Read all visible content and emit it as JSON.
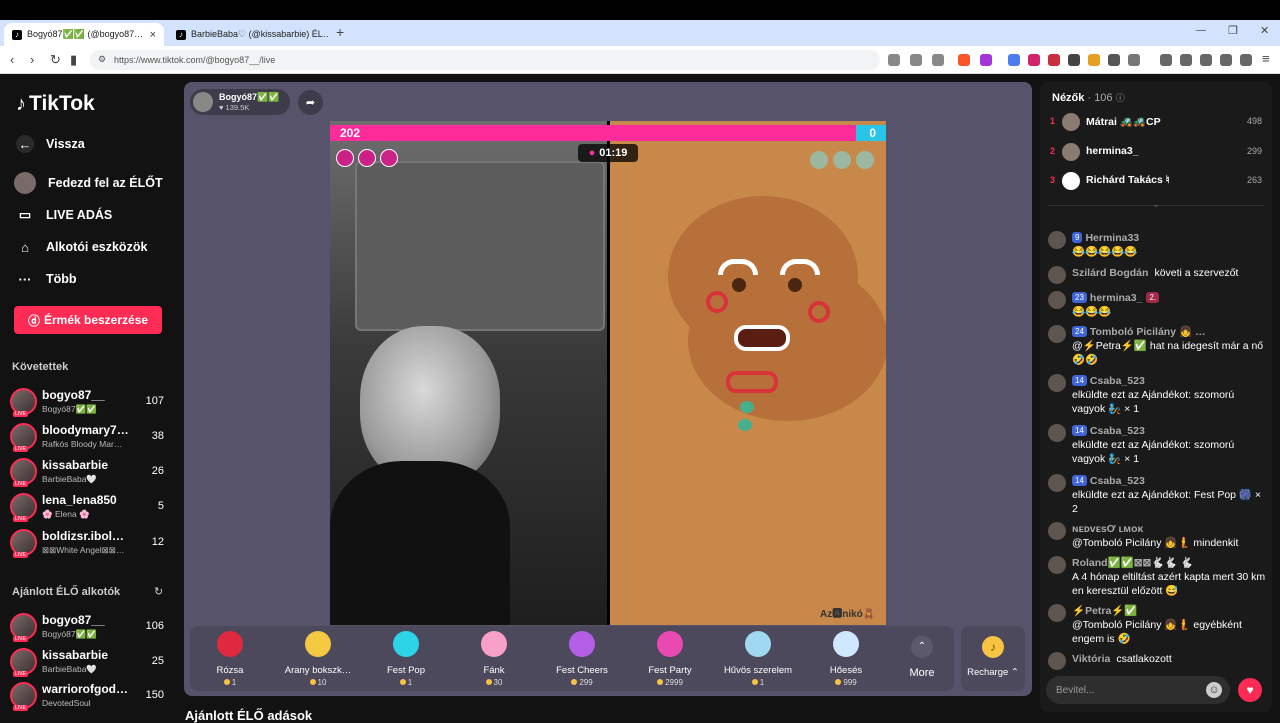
{
  "browser": {
    "tabs": [
      {
        "title": "Bogyó87✅✅ (@bogyo87…",
        "close": "×"
      },
      {
        "title": "BarbieBaba♡ (@kissabarbie) ÉL…"
      }
    ],
    "new_tab": "+",
    "url": "https://www.tiktok.com/@bogyo87__/live",
    "window": {
      "min": "—",
      "restore": "❐",
      "close": "✕"
    }
  },
  "sidebar": {
    "logo": "TikTok",
    "menu": [
      {
        "label": "Vissza",
        "icon": "arrow-left-icon"
      },
      {
        "label": "Fedezd fel az ÉLŐT",
        "icon": "avatar"
      },
      {
        "label": "LIVE ADÁS",
        "icon": "camera-icon"
      },
      {
        "label": "Alkotói eszközök",
        "icon": "lightbulb-icon"
      },
      {
        "label": "Több",
        "icon": "more-icon"
      }
    ],
    "coin_button": "Érmék beszerzése",
    "following_header": "Követettek",
    "following": [
      {
        "name": "bogyo87__",
        "sub": "Bogyó87✅✅",
        "count": "107"
      },
      {
        "name": "bloodymary7…",
        "sub": "Rafkós Bloody Mar…",
        "count": "38"
      },
      {
        "name": "kissabarbie",
        "sub": "BarbieBaba🤍",
        "count": "26"
      },
      {
        "name": "lena_lena850",
        "sub": "🌸 Elena 🌸",
        "count": "5"
      },
      {
        "name": "boldizsr.ibol…",
        "sub": "⊠⊠White Angel⊠⊠…",
        "count": "12"
      }
    ],
    "recommended_header": "Ajánlott ÉLŐ alkotók",
    "recommended": [
      {
        "name": "bogyo87__",
        "sub": "Bogyó87✅✅",
        "count": "106"
      },
      {
        "name": "kissabarbie",
        "sub": "BarbieBaba🤍",
        "count": "25"
      },
      {
        "name": "warriorofgod…",
        "sub": "DevotedSoul",
        "count": "150"
      }
    ],
    "live_badge": "LIVE"
  },
  "host": {
    "name": "Bogyó87✅✅",
    "likes": "♥ 139.5K"
  },
  "battle": {
    "left_score": "202",
    "right_score": "0",
    "timer": "01:19",
    "right_caption": "Az🅰nikó🧸"
  },
  "gifts": [
    {
      "name": "Rózsa",
      "price": "1",
      "color": "#e0283e"
    },
    {
      "name": "Arany bokszk…",
      "price": "10",
      "color": "#f5c842"
    },
    {
      "name": "Fest Pop",
      "price": "1",
      "color": "#2dd4e8"
    },
    {
      "name": "Fánk",
      "price": "30",
      "color": "#f7a0c8"
    },
    {
      "name": "Fest Cheers",
      "price": "299",
      "color": "#b45ee8"
    },
    {
      "name": "Fest Party",
      "price": "2999",
      "color": "#e84ab2"
    },
    {
      "name": "Hűvös szerelem",
      "price": "1",
      "color": "#9fd8f0"
    },
    {
      "name": "Hőesés",
      "price": "999",
      "color": "#cfe8ff"
    }
  ],
  "more_label": "More",
  "recharge_label": "Recharge",
  "recommended_live": "Ajánlott ÉLŐ adások",
  "viewers": {
    "title": "Nézők",
    "count": "· 106",
    "top": [
      {
        "rank": "1",
        "name": "Mátrai 🚜🚜CP",
        "coins": "498"
      },
      {
        "rank": "2",
        "name": "hermina3_",
        "coins": "299"
      },
      {
        "rank": "3",
        "name": "Richárd Takács ♮",
        "coins": "263"
      }
    ]
  },
  "chat": [
    {
      "lvl": "9",
      "user": "Hermina33",
      "text": "😂😂😂😂😂"
    },
    {
      "lvl": "",
      "user": "Szilárd Bogdán",
      "text": "követi a szervezőt"
    },
    {
      "lvl": "23",
      "user": "hermina3_",
      "text": "😂😂😂",
      "tag": "2."
    },
    {
      "lvl": "24",
      "user": "Tomboló Picilány 👧 …",
      "text": "@⚡Petra⚡✅ hat na idegesít már a nő🤣🤣"
    },
    {
      "lvl": "14",
      "user": "Csaba_523",
      "text": "elküldte ezt az Ajándékot: szomorú vagyok 🧞 × 1"
    },
    {
      "lvl": "14",
      "user": "Csaba_523",
      "text": "elküldte ezt az Ajándékot: szomorú vagyok 🧞 × 1"
    },
    {
      "lvl": "14",
      "user": "Csaba_523",
      "text": "elküldte ezt az Ajándékot: Fest Pop 🎆 × 2"
    },
    {
      "lvl": "",
      "user": "ɴᴇᴅᴠᴇsƠ ʟᴍᴏᴋ",
      "text": "@Tomboló Picilány 👧🧜 mindenkit"
    },
    {
      "lvl": "",
      "user": "Roland✅✅⊠⊠🐇🐇 🐇",
      "text": "A 4 hónap eltiltást azért kapta mert 30 km en keresztül előzött 😅"
    },
    {
      "lvl": "",
      "user": "⚡Petra⚡✅",
      "text": "@Tomboló Picilány 👧🧜 egyébként engem is 🤣"
    },
    {
      "lvl": "",
      "user": "Viktória",
      "text": "csatlakozott"
    }
  ],
  "input_placeholder": "Bevitel..."
}
